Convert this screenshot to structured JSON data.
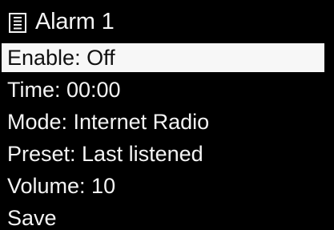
{
  "header": {
    "title": "Alarm 1",
    "icon": "menu-list-icon"
  },
  "menu": {
    "selected_index": 0,
    "items": [
      {
        "label": "Enable: Off"
      },
      {
        "label": "Time: 00:00"
      },
      {
        "label": "Mode: Internet Radio"
      },
      {
        "label": "Preset: Last listened"
      },
      {
        "label": "Volume: 10"
      },
      {
        "label": "Save"
      }
    ]
  },
  "colors": {
    "background": "#000000",
    "text": "#f4f4f4",
    "highlight_bg": "#f7f7f7",
    "highlight_text": "#111111"
  }
}
